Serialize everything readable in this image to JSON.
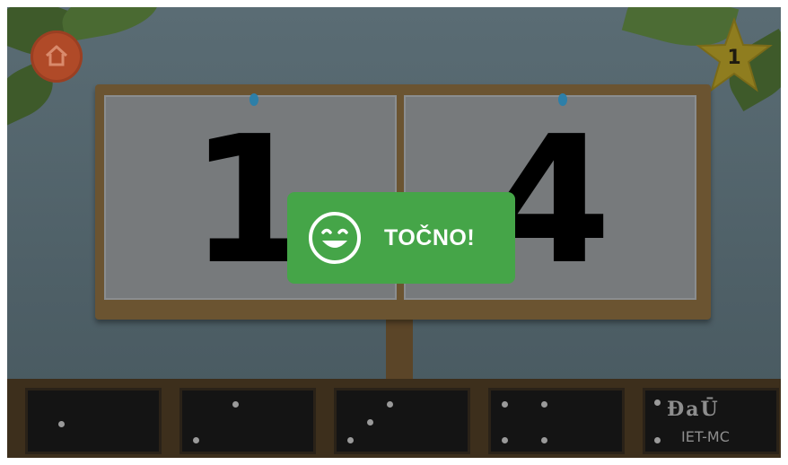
{
  "hud": {
    "home_icon": "home-icon",
    "star_icon": "star-icon",
    "star_count": "1"
  },
  "board": {
    "left_digit": "1",
    "right_digit": "4"
  },
  "feedback": {
    "icon": "smiley-icon",
    "text": "TOČNO!",
    "color": "#45a548"
  },
  "tiles": [
    {
      "dots": 1
    },
    {
      "dots": 2
    },
    {
      "dots": 3
    },
    {
      "dots": 4
    }
  ],
  "brand": {
    "main": "ĐaŪ",
    "sub": "IET-MC"
  }
}
